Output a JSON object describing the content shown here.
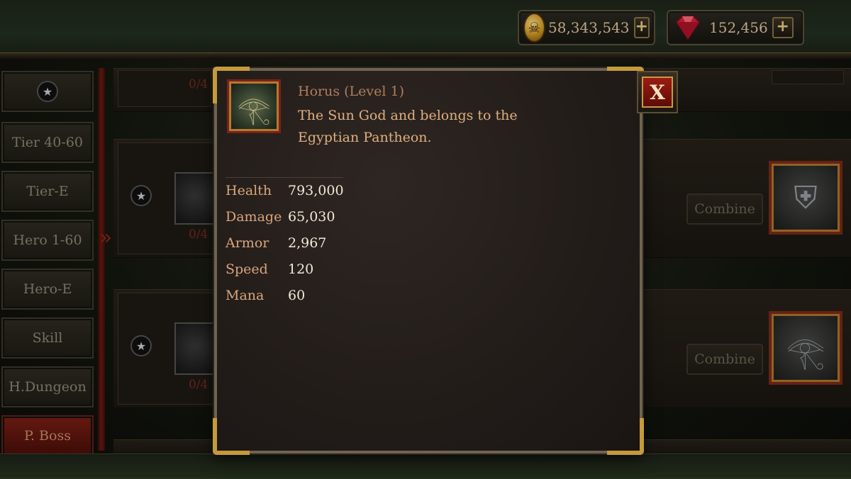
{
  "currencies": [
    {
      "name": "gold",
      "icon": "skull-coin-icon",
      "value": "58,343,543"
    },
    {
      "name": "gems",
      "icon": "ruby-gem-icon",
      "value": "152,456"
    }
  ],
  "plus_label": "+",
  "sidebar": {
    "items": [
      {
        "label": "",
        "icon": "star-icon"
      },
      {
        "label": "Tier 40-60"
      },
      {
        "label": "Tier-E"
      },
      {
        "label": "Hero 1-60"
      },
      {
        "label": "Hero-E"
      },
      {
        "label": "Skill"
      },
      {
        "label": "H.Dungeon"
      },
      {
        "label": "P. Boss",
        "active": true
      }
    ]
  },
  "rows": [
    {
      "count": "0/4"
    },
    {
      "count": "0/4",
      "combine": "Combine"
    },
    {
      "count": "0/4",
      "combine": "Combine"
    }
  ],
  "dialog": {
    "title": "Horus (Level 1)",
    "description": "The Sun God and belongs to the Egyptian Pantheon.",
    "stats": [
      {
        "label": "Health",
        "value": "793,000"
      },
      {
        "label": "Damage",
        "value": "65,030"
      },
      {
        "label": "Armor",
        "value": "2,967"
      },
      {
        "label": "Speed",
        "value": "120"
      },
      {
        "label": "Mana",
        "value": "60"
      }
    ],
    "close_label": "X"
  },
  "colors": {
    "accent_gold": "#c59a3c",
    "active_red": "#7a1f14",
    "stat_label": "#d9a57c"
  }
}
